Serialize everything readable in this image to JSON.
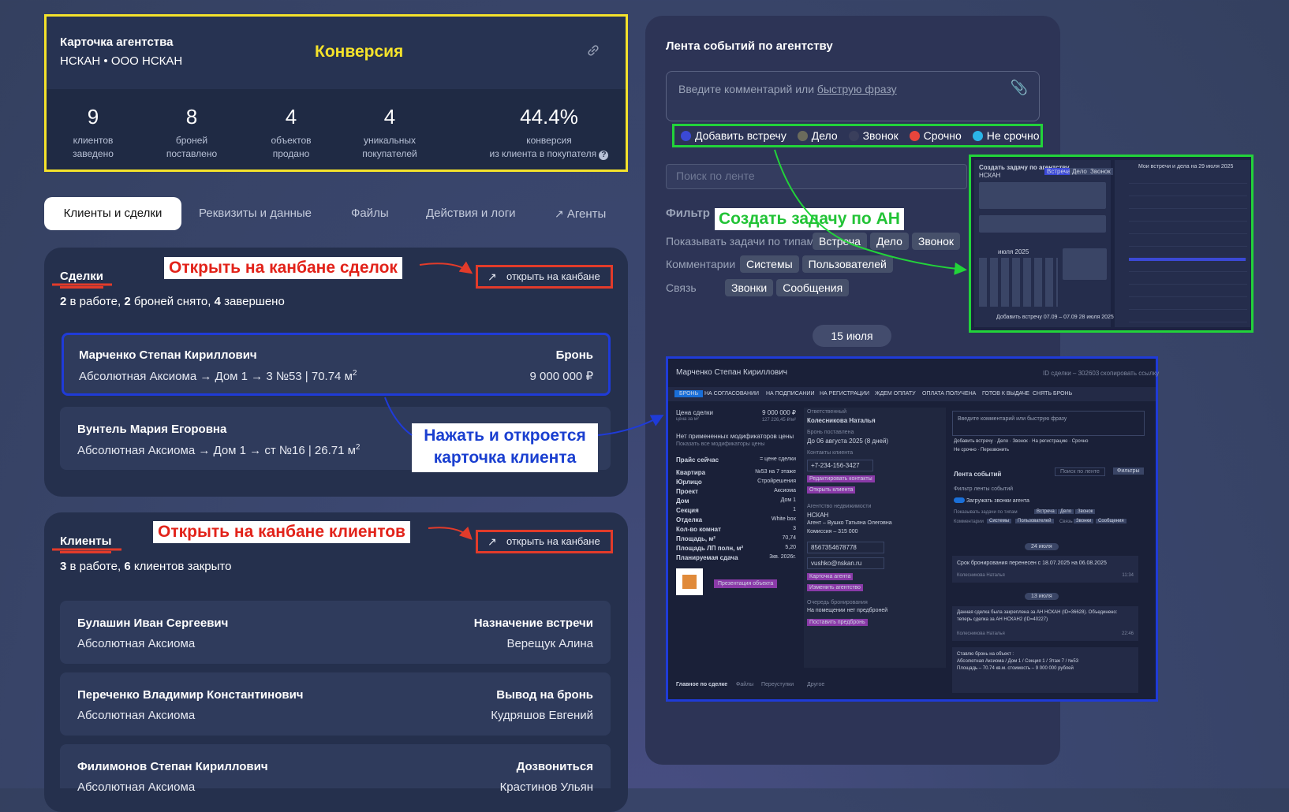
{
  "agency_card": {
    "title": "Карточка агентства",
    "subtitle": "НСКАН • ООО НСКАН",
    "annotation": "Конверсия",
    "stats": [
      {
        "value": "9",
        "label1": "клиентов",
        "label2": "заведено"
      },
      {
        "value": "8",
        "label1": "броней",
        "label2": "поставлено"
      },
      {
        "value": "4",
        "label1": "объектов",
        "label2": "продано"
      },
      {
        "value": "4",
        "label1": "уникальных",
        "label2": "покупателей"
      },
      {
        "value": "44.4%",
        "label1": "конверсия",
        "label2": "из клиента в покупателя"
      }
    ]
  },
  "tabs": [
    "Клиенты и сделки",
    "Реквизиты и данные",
    "Файлы",
    "Действия и логи",
    "Агенты"
  ],
  "deals": {
    "title": "Сделки",
    "summary_a": "2",
    "summary_b": " в работе, ",
    "summary_c": "2",
    "summary_d": " броней снято, ",
    "summary_e": "4",
    "summary_f": " завершено",
    "kanban_label": "открыть на канбане",
    "annotation": "Открыть на канбане сделок",
    "click_annotation_1": "Нажать и откроется",
    "click_annotation_2": "карточка клиента",
    "rows": [
      {
        "name": "Марченко Степан Кириллович",
        "object": "Абсолютная Аксиома → Дом 1 → 3 №53 | 70.74 м",
        "sup": "2",
        "status": "Бронь",
        "price": "9 000 000 ₽"
      },
      {
        "name": "Вунтель Мария Егоровна",
        "object": "Абсолютная Аксиома → Дом 1 → ст №16 | 26.71 м",
        "sup": "2",
        "status": "",
        "price": ""
      }
    ]
  },
  "clients": {
    "title": "Клиенты",
    "summary_a": "3",
    "summary_b": " в работе, ",
    "summary_c": "6",
    "summary_d": " клиентов закрыто",
    "kanban_label": "открыть на канбане",
    "annotation": "Открыть на канбане клиентов",
    "rows": [
      {
        "name": "Булашин Иван Сергеевич",
        "project": "Абсолютная Аксиома",
        "stage": "Назначение встречи",
        "agent": "Верещук Алина"
      },
      {
        "name": "Переченко Владимир Константинович",
        "project": "Абсолютная Аксиома",
        "stage": "Вывод на бронь",
        "agent": "Кудряшов Евгений"
      },
      {
        "name": "Филимонов Степан Кириллович",
        "project": "Абсолютная Аксиома",
        "stage": "Дозвониться",
        "agent": "Крастинов Ульян"
      }
    ]
  },
  "feed": {
    "title": "Лента событий по агентству",
    "comment_placeholder": "Введите комментарий или ",
    "comment_link": "быструю фразу",
    "quick_actions": [
      {
        "label": "Добавить встречу",
        "color": "#3b49d6"
      },
      {
        "label": "Дело",
        "color": "#6b6b5c"
      },
      {
        "label": "Звонок",
        "color": "#3a3f5c"
      },
      {
        "label": "Срочно",
        "color": "#e8453c"
      },
      {
        "label": "Не срочно",
        "color": "#2bb5e8"
      }
    ],
    "search_placeholder": "Поиск по ленте",
    "filter_title": "Фильтр",
    "task_annotation": "Создать задачу по АН",
    "filter_types_label": "Показывать задачи по типам",
    "filter_types": [
      "Встреча",
      "Дело",
      "Звонок"
    ],
    "comments_label": "Комментарии",
    "comments_chips": [
      "Системы",
      "Пользователей"
    ],
    "link_label": "Связь",
    "link_chips": [
      "Звонки",
      "Сообщения"
    ],
    "date_pill": "15 июля"
  },
  "deal_preview": {
    "client": "Марченко Степан Кириллович",
    "deal_id": "ID сделки – 302603",
    "copy_link": "скопировать ссылку",
    "stages": [
      "БРОНЬ",
      "НА СОГЛАСОВАНИИ",
      "НА ПОДПИСАНИИ",
      "НА РЕГИСТРАЦИИ",
      "ЖДЕМ ОПЛАТУ",
      "ОПЛАТА ПОЛУЧЕНА",
      "ГОТОВ К ВЫДАЧЕ",
      "СНЯТЬ БРОНЬ"
    ],
    "price_label": "Цена сделки",
    "price": "9 000 000 ₽",
    "price_sub": "цена за м²",
    "price_sub_val": "127 226,45 ₽/м²",
    "no_mods": "Нет примененных модификаторов цены",
    "show_mods": "Показать все модификаторы цены",
    "pricelist": "Прайс сейчас",
    "pricelist_val": "= цене сделки",
    "props": [
      {
        "k": "Квартира",
        "v": "№53 на 7 этаже"
      },
      {
        "k": "Юрлицо",
        "v": "Стройрешения"
      },
      {
        "k": "Проект",
        "v": "Аксиома"
      },
      {
        "k": "Дом",
        "v": "Дом 1"
      },
      {
        "k": "Секция",
        "v": "1"
      },
      {
        "k": "Отделка",
        "v": "White box"
      },
      {
        "k": "Кол-во комнат",
        "v": "3"
      },
      {
        "k": "Площадь, м²",
        "v": "70,74"
      },
      {
        "k": "Площадь ЛП полн, м²",
        "v": "5,20"
      },
      {
        "k": "Планируемая сдача",
        "v": "3кв. 2026г."
      }
    ],
    "presentation_btn": "Презентация объекта",
    "responsible_label": "Ответственный",
    "responsible": "Колесникова Наталья",
    "reserved_label": "Бронь поставлена",
    "reserved": "До 06 августа 2025 (8 дней)",
    "contacts_label": "Контакты клиента",
    "phone": "+7-234-156-3427",
    "edit_contacts": "Редактировать контакты",
    "open_client": "Открыть клиента",
    "agency_label": "Агентство недвижимости",
    "agency": "НСКАН",
    "agent": "Агент – Вушко Татьяна Олеговна",
    "commission": "Комиссия – 315 000",
    "agent_phone": "8567354678778",
    "agent_email": "vushko@nskan.ru",
    "agent_card": "Карточка агента",
    "change_agency": "Изменить агентство",
    "queue_label": "Очередь бронирования",
    "queue": "На помещении нет предброней",
    "set_prebook": "Поставить предбронь",
    "bottom_tabs": [
      "Главное по сделке",
      "Файлы",
      "Переуступки",
      "Другое"
    ],
    "comment_placeholder": "Введите комментарий или быструю фразу",
    "quick": [
      "Добавить встречу",
      "Дело",
      "Звонок",
      "На регистрацию",
      "Срочно",
      "Не срочно",
      "Перезвонить"
    ],
    "feed_title": "Лента событий",
    "feed_search": "Поиск по ленте",
    "feed_filters": "Фильтры",
    "feed_filter_label": "Фильтр ленты событий",
    "load_calls": "Загружать звонки агента",
    "show_types": "Показывать задачи по типам",
    "type_chips": [
      "Встреча",
      "Дело",
      "Звонок"
    ],
    "comments": "Комментарии",
    "comment_chips": [
      "Системы",
      "Пользователей"
    ],
    "link": "Связь",
    "link_chips": [
      "Звонки",
      "Сообщения"
    ],
    "date1": "24 июля",
    "event1": "Срок бронирования перенесен с 18.07.2025 на 06.08.2025",
    "event1_author": "Колесникова Наталья",
    "event1_time": "11:34",
    "date2": "13 июля",
    "event2a": "Данная сделка была закреплена за АН НСКАН (ID=36628). Объединено:",
    "event2b": "теперь сделка за АН НСКАН2 (ID=40227)",
    "event2_author": "Колесникова Наталья",
    "event2_time": "22:46",
    "event3a": "Ставлю бронь на объект :",
    "event3b": "Абсолютная Аксиома / Дом 1 / Секция 1 / Этаж 7 / №53",
    "event3c": "Площадь – 70.74 кв.м. стоимость – 9 000 000 рублей"
  },
  "task_preview": {
    "title": "Создать задачу по агентству",
    "agency": "НСКАН",
    "tabs": [
      "Встреча",
      "Дело",
      "Звонок"
    ],
    "month": "июля 2025",
    "add_meeting": "Добавить встречу 07.09 – 07.09 28 июля 2025",
    "calendar_title": "Мои встречи и дела на 29 июля 2025"
  },
  "colors": {
    "accent_yellow": "#f4e22b",
    "accent_red": "#e23b2a",
    "accent_blue": "#1f3bd8",
    "accent_green": "#22d33a"
  }
}
